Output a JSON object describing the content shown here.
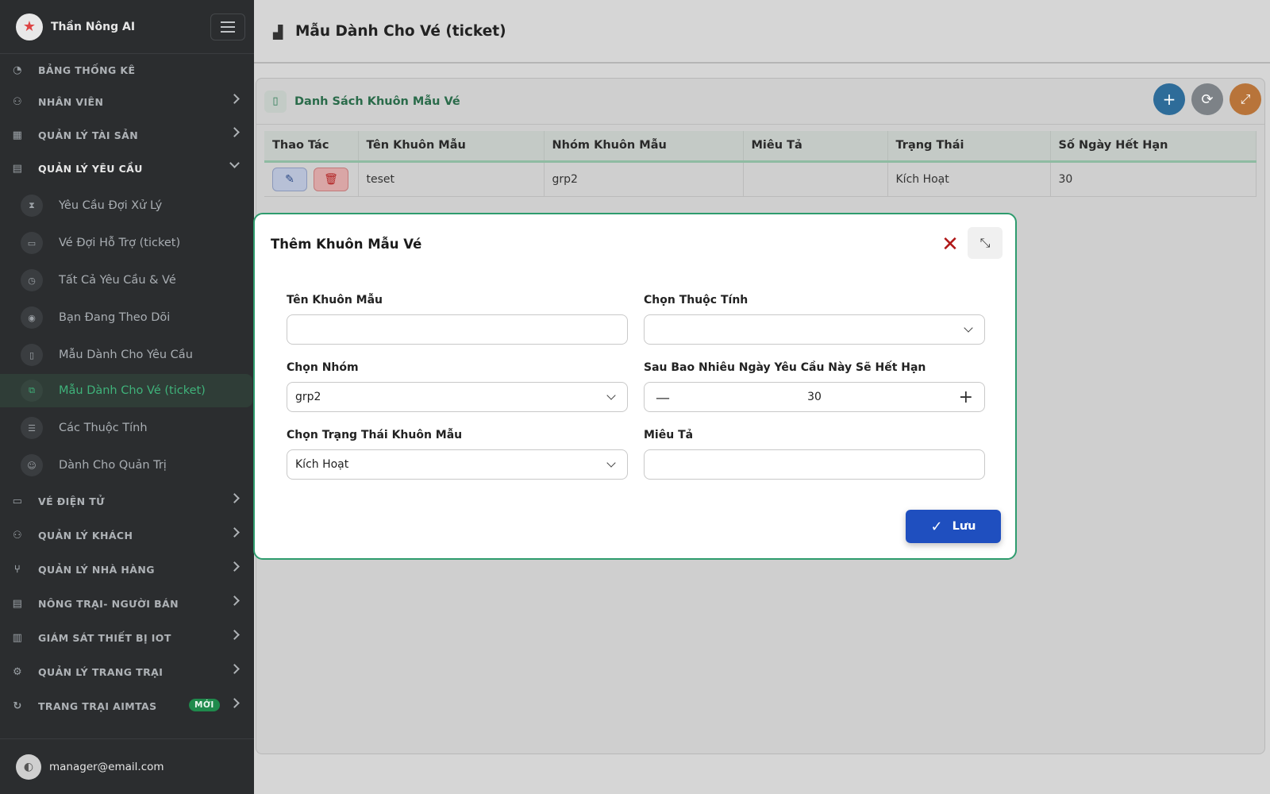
{
  "app": {
    "name": "Thần Nông AI",
    "logo_icon": "star-logo"
  },
  "sidebar": {
    "items": [
      {
        "label": "BẢNG THỐNG KÊ",
        "icon": "dashboard-icon",
        "expandable": false
      },
      {
        "label": "NHÂN VIÊN",
        "icon": "users-icon",
        "expandable": true
      },
      {
        "label": "QUẢN LÝ TÀI SẢN",
        "icon": "assets-icon",
        "expandable": true
      },
      {
        "label": "QUẢN LÝ YÊU CẦU",
        "icon": "clipboard-icon",
        "expandable": true,
        "open": true
      },
      {
        "label": "VÉ ĐIỆN TỬ",
        "icon": "ticket-icon",
        "expandable": true
      },
      {
        "label": "QUẢN LÝ KHÁCH",
        "icon": "guests-icon",
        "expandable": true
      },
      {
        "label": "QUẢN LÝ NHÀ HÀNG",
        "icon": "restaurant-icon",
        "expandable": true
      },
      {
        "label": "NÔNG TRẠI- NGƯỜI BÁN",
        "icon": "store-icon",
        "expandable": true
      },
      {
        "label": "GIÁM SÁT THIẾT BỊ IOT",
        "icon": "factory-icon",
        "expandable": true
      },
      {
        "label": "QUẢN LÝ TRANG TRẠI",
        "icon": "tractor-icon",
        "expandable": true
      },
      {
        "label": "TRANG TRẠI AIMTAS",
        "icon": "farm-icon",
        "expandable": true,
        "badge": "MỚI"
      }
    ],
    "sub_items": [
      {
        "label": "Yêu Cầu Đợi Xử Lý",
        "icon": "hourglass-icon"
      },
      {
        "label": "Vé Đợi Hỗ Trợ (ticket)",
        "icon": "ticket-icon"
      },
      {
        "label": "Tất Cả Yêu Cầu & Vé",
        "icon": "history-icon"
      },
      {
        "label": "Bạn Đang Theo Dõi",
        "icon": "eye-icon"
      },
      {
        "label": "Mẫu Dành Cho Yêu Cầu",
        "icon": "document-icon"
      },
      {
        "label": "Mẫu Dành Cho Vé (ticket)",
        "icon": "copy-icon",
        "active": true
      },
      {
        "label": "Các Thuộc Tính",
        "icon": "sliders-icon"
      },
      {
        "label": "Dành Cho Quản Trị",
        "icon": "admin-icon"
      }
    ],
    "user_email": "manager@email.com"
  },
  "header": {
    "title": "Mẫu Dành Cho Vé (ticket)",
    "icon": "bar-chart-icon"
  },
  "card": {
    "title": "Danh Sách Khuôn Mẫu Vé",
    "add_label": "+",
    "refresh_label": "⟳",
    "expand_label": "⤢"
  },
  "table": {
    "columns": [
      "Thao Tác",
      "Tên Khuôn Mẫu",
      "Nhóm Khuôn Mẫu",
      "Miêu Tả",
      "Trạng Thái",
      "Số Ngày Hết Hạn"
    ],
    "rows": [
      {
        "name": "teset",
        "group": "grp2",
        "description": "",
        "status": "Kích Hoạt",
        "days": "30"
      }
    ]
  },
  "modal": {
    "title": "Thêm Khuôn Mẫu Vé",
    "fields": {
      "template_name": {
        "label": "Tên Khuôn Mẫu",
        "value": ""
      },
      "attribute": {
        "label": "Chọn Thuộc Tính",
        "value": ""
      },
      "group": {
        "label": "Chọn Nhóm",
        "value": "grp2"
      },
      "expiry_days": {
        "label": "Sau Bao Nhiêu Ngày Yêu Cầu Này Sẽ Hết Hạn",
        "value": "30"
      },
      "status": {
        "label": "Chọn Trạng Thái Khuôn Mẫu",
        "value": "Kích Hoạt"
      },
      "description": {
        "label": "Miêu Tả",
        "value": ""
      }
    },
    "save_label": "Lưu"
  },
  "colors": {
    "accent_green": "#2e9c6e",
    "primary_blue": "#1f4fbf",
    "sidebar_bg": "#2b2d2f"
  }
}
